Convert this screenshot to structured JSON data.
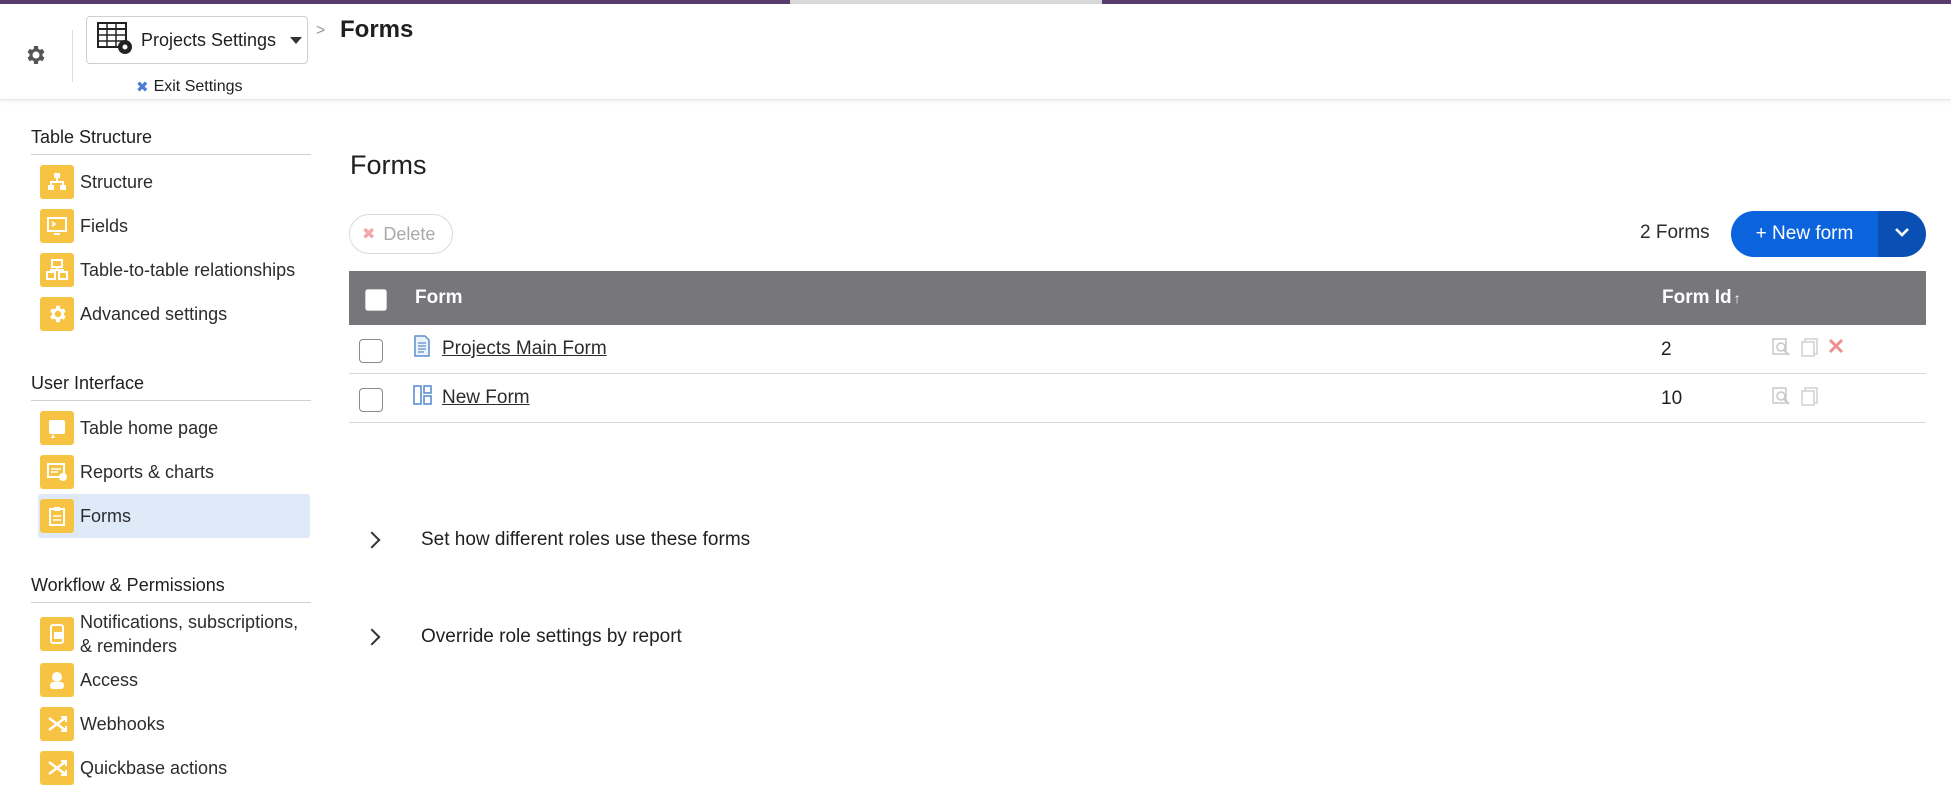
{
  "header": {
    "project_button_label": "Projects Settings",
    "breadcrumb_separator": ">",
    "page_crumb": "Forms",
    "exit_settings_label": "Exit Settings"
  },
  "sidebar": {
    "sections": [
      {
        "title": "Table Structure",
        "items": [
          {
            "label": "Structure",
            "icon": "structure-icon"
          },
          {
            "label": "Fields",
            "icon": "fields-icon"
          },
          {
            "label": "Table-to-table relationships",
            "icon": "relationships-icon"
          },
          {
            "label": "Advanced settings",
            "icon": "gear-icon"
          }
        ]
      },
      {
        "title": "User Interface",
        "items": [
          {
            "label": "Table home page",
            "icon": "home-page-icon"
          },
          {
            "label": "Reports & charts",
            "icon": "reports-icon"
          },
          {
            "label": "Forms",
            "icon": "forms-icon",
            "active": true
          }
        ]
      },
      {
        "title": "Workflow & Permissions",
        "items": [
          {
            "label": "Notifications, subscriptions, & reminders",
            "icon": "notifications-icon"
          },
          {
            "label": "Access",
            "icon": "access-icon"
          },
          {
            "label": "Webhooks",
            "icon": "webhooks-icon"
          },
          {
            "label": "Quickbase actions",
            "icon": "actions-icon"
          }
        ]
      }
    ]
  },
  "main": {
    "title": "Forms",
    "delete_label": "Delete",
    "count_label": "2 Forms",
    "new_button_label": "+ New form",
    "table": {
      "columns": [
        "Form",
        "Form Id"
      ],
      "sort_indicator": "↑",
      "rows": [
        {
          "name": "Projects Main Form",
          "id": "2",
          "icon": "form-doc-icon",
          "actions": [
            "preview-icon",
            "copy-icon",
            "delete-icon"
          ]
        },
        {
          "name": "New Form",
          "id": "10",
          "icon": "form-layout-icon",
          "actions": [
            "preview-icon",
            "copy-icon"
          ]
        }
      ]
    },
    "expanders": [
      {
        "label": "Set how different roles use these forms"
      },
      {
        "label": "Override role settings by report"
      }
    ]
  },
  "colors": {
    "accent_blue": "#0b64dd",
    "accent_blue_dark": "#0a4fb4",
    "icon_yellow": "#f6c342",
    "table_header": "#77767a",
    "active_nav": "#dfeaf8",
    "top_stripe": "#5a3b6e"
  }
}
